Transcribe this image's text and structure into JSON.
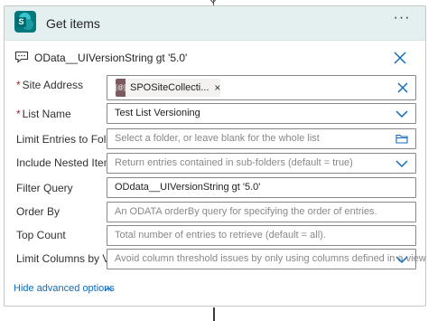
{
  "header": {
    "app_icon": "sharepoint-icon",
    "app_icon_letter": "S",
    "title": "Get items",
    "more_label": "···"
  },
  "subheader": {
    "comment_icon": "comment-icon",
    "title": "OData__UIVersionString gt '5.0'",
    "close_icon": "close-icon"
  },
  "fields": {
    "site_address": {
      "label": "Site Address",
      "required_marker": "*",
      "token_icon_text": "[@]",
      "token_label": "SPOSiteCollecti...",
      "token_remove": "×"
    },
    "list_name": {
      "label": "List Name",
      "required_marker": "*",
      "value": "Test List Versioning"
    },
    "limit_entries": {
      "label": "Limit Entries to Folder",
      "placeholder": "Select a folder, or leave blank for the whole list"
    },
    "include_nested": {
      "label": "Include Nested Items",
      "placeholder": "Return entries contained in sub-folders (default = true)"
    },
    "filter_query": {
      "label": "Filter Query",
      "value": "ODdata__UIVersionString gt '5.0'"
    },
    "order_by": {
      "label": "Order By",
      "placeholder": "An ODATA orderBy query for specifying the order of entries."
    },
    "top_count": {
      "label": "Top Count",
      "placeholder": "Total number of entries to retrieve (default = all)."
    },
    "limit_columns": {
      "label": "Limit Columns by View",
      "placeholder": "Avoid column threshold issues by only using columns defined in a view"
    }
  },
  "advanced": {
    "label": "Hide advanced options",
    "chevron_icon": "chevron-up-icon"
  },
  "colors": {
    "header_bg": "#e3f0ef",
    "accent": "#0f6cbd",
    "sharepoint": "#03787c"
  }
}
